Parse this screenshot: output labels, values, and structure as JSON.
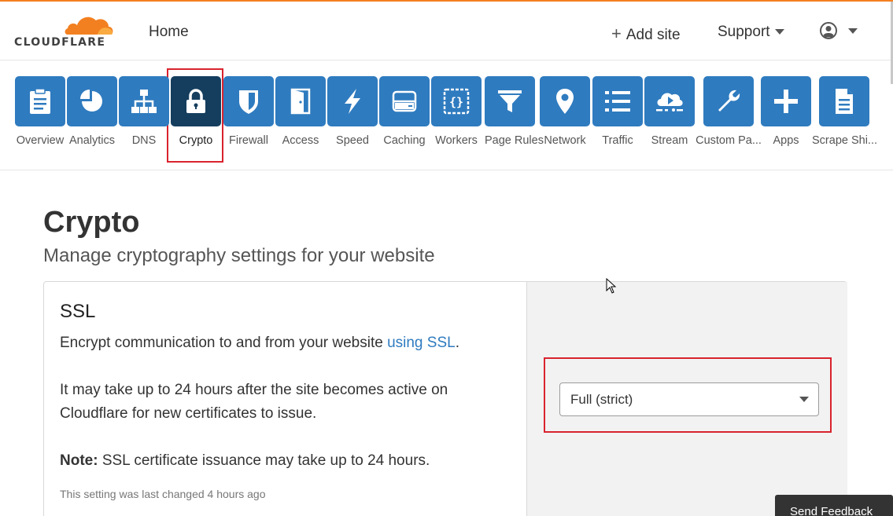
{
  "header": {
    "logo_text": "CLOUDFLARE",
    "home_label": "Home",
    "add_site_label": "Add site",
    "support_label": "Support"
  },
  "nav": {
    "items": [
      {
        "label": "Overview",
        "icon": "clipboard-icon"
      },
      {
        "label": "Analytics",
        "icon": "pie-chart-icon"
      },
      {
        "label": "DNS",
        "icon": "network-tree-icon"
      },
      {
        "label": "Crypto",
        "icon": "lock-icon",
        "active": true
      },
      {
        "label": "Firewall",
        "icon": "shield-icon"
      },
      {
        "label": "Access",
        "icon": "door-icon"
      },
      {
        "label": "Speed",
        "icon": "lightning-icon"
      },
      {
        "label": "Caching",
        "icon": "server-icon"
      },
      {
        "label": "Workers",
        "icon": "code-braces-icon"
      },
      {
        "label": "Page Rules",
        "icon": "filter-icon"
      },
      {
        "label": "Network",
        "icon": "location-pin-icon"
      },
      {
        "label": "Traffic",
        "icon": "list-icon"
      },
      {
        "label": "Stream",
        "icon": "cloud-play-icon"
      },
      {
        "label": "Custom Pa...",
        "icon": "wrench-icon"
      },
      {
        "label": "Apps",
        "icon": "plus-icon"
      },
      {
        "label": "Scrape Shi...",
        "icon": "document-icon"
      }
    ]
  },
  "page": {
    "title": "Crypto",
    "subtitle": "Manage cryptography settings for your website"
  },
  "ssl_card": {
    "title": "SSL",
    "description_prefix": "Encrypt communication to and from your website ",
    "description_link": "using SSL",
    "description_suffix": ".",
    "delay_text": "It may take up to 24 hours after the site becomes active on Cloudflare for new certificates to issue.",
    "note_label": "Note:",
    "note_text": " SSL certificate issuance may take up to 24 hours.",
    "last_changed": "This setting was last changed 4 hours ago",
    "ssl_mode_value": "Full (strict)"
  },
  "feedback_label": "Send Feedback",
  "colors": {
    "accent_orange": "#f38020",
    "tile_blue": "#2f7bbf",
    "tile_active": "#153e5e",
    "highlight_red": "#d9232e"
  }
}
